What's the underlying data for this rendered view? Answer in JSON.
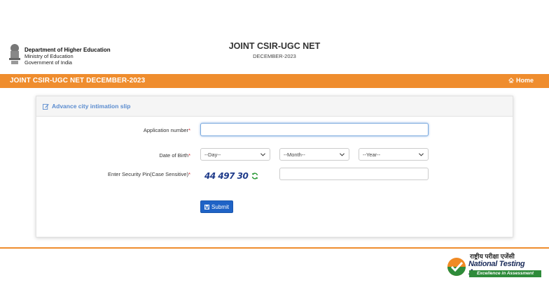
{
  "header": {
    "dept_line1": "Department of Higher Education",
    "dept_line2": "Ministry of Education",
    "dept_line3": "Government of India",
    "exam_title": "JOINT CSIR-UGC NET",
    "exam_subtitle": "DECEMBER-2023"
  },
  "navbar": {
    "title": "JOINT CSIR-UGC NET DECEMBER-2023",
    "home_label": "Home",
    "color": "#ef8d2e"
  },
  "card": {
    "title": "Advance city intimation slip"
  },
  "form": {
    "application_label": "Application number",
    "application_value": "",
    "dob_label": "Date of Birth",
    "day_placeholder": "--Day--",
    "month_placeholder": "--Month--",
    "year_placeholder": "--Year--",
    "pin_label": "Enter Security Pin(Case Sensitive)",
    "captcha_text": "44 497 30",
    "pin_value": "",
    "required_mark": "*",
    "submit_label": "Submit"
  },
  "footer": {
    "nta_hindi": "राष्ट्रीय परीक्षा एजेंसी",
    "nta_name": "National Testing Agency",
    "nta_tagline": "Excellence in Assessment"
  },
  "icons": {
    "emblem": "national-emblem-icon",
    "home": "home-icon",
    "edit": "edit-icon",
    "refresh": "refresh-icon",
    "save": "save-icon"
  }
}
